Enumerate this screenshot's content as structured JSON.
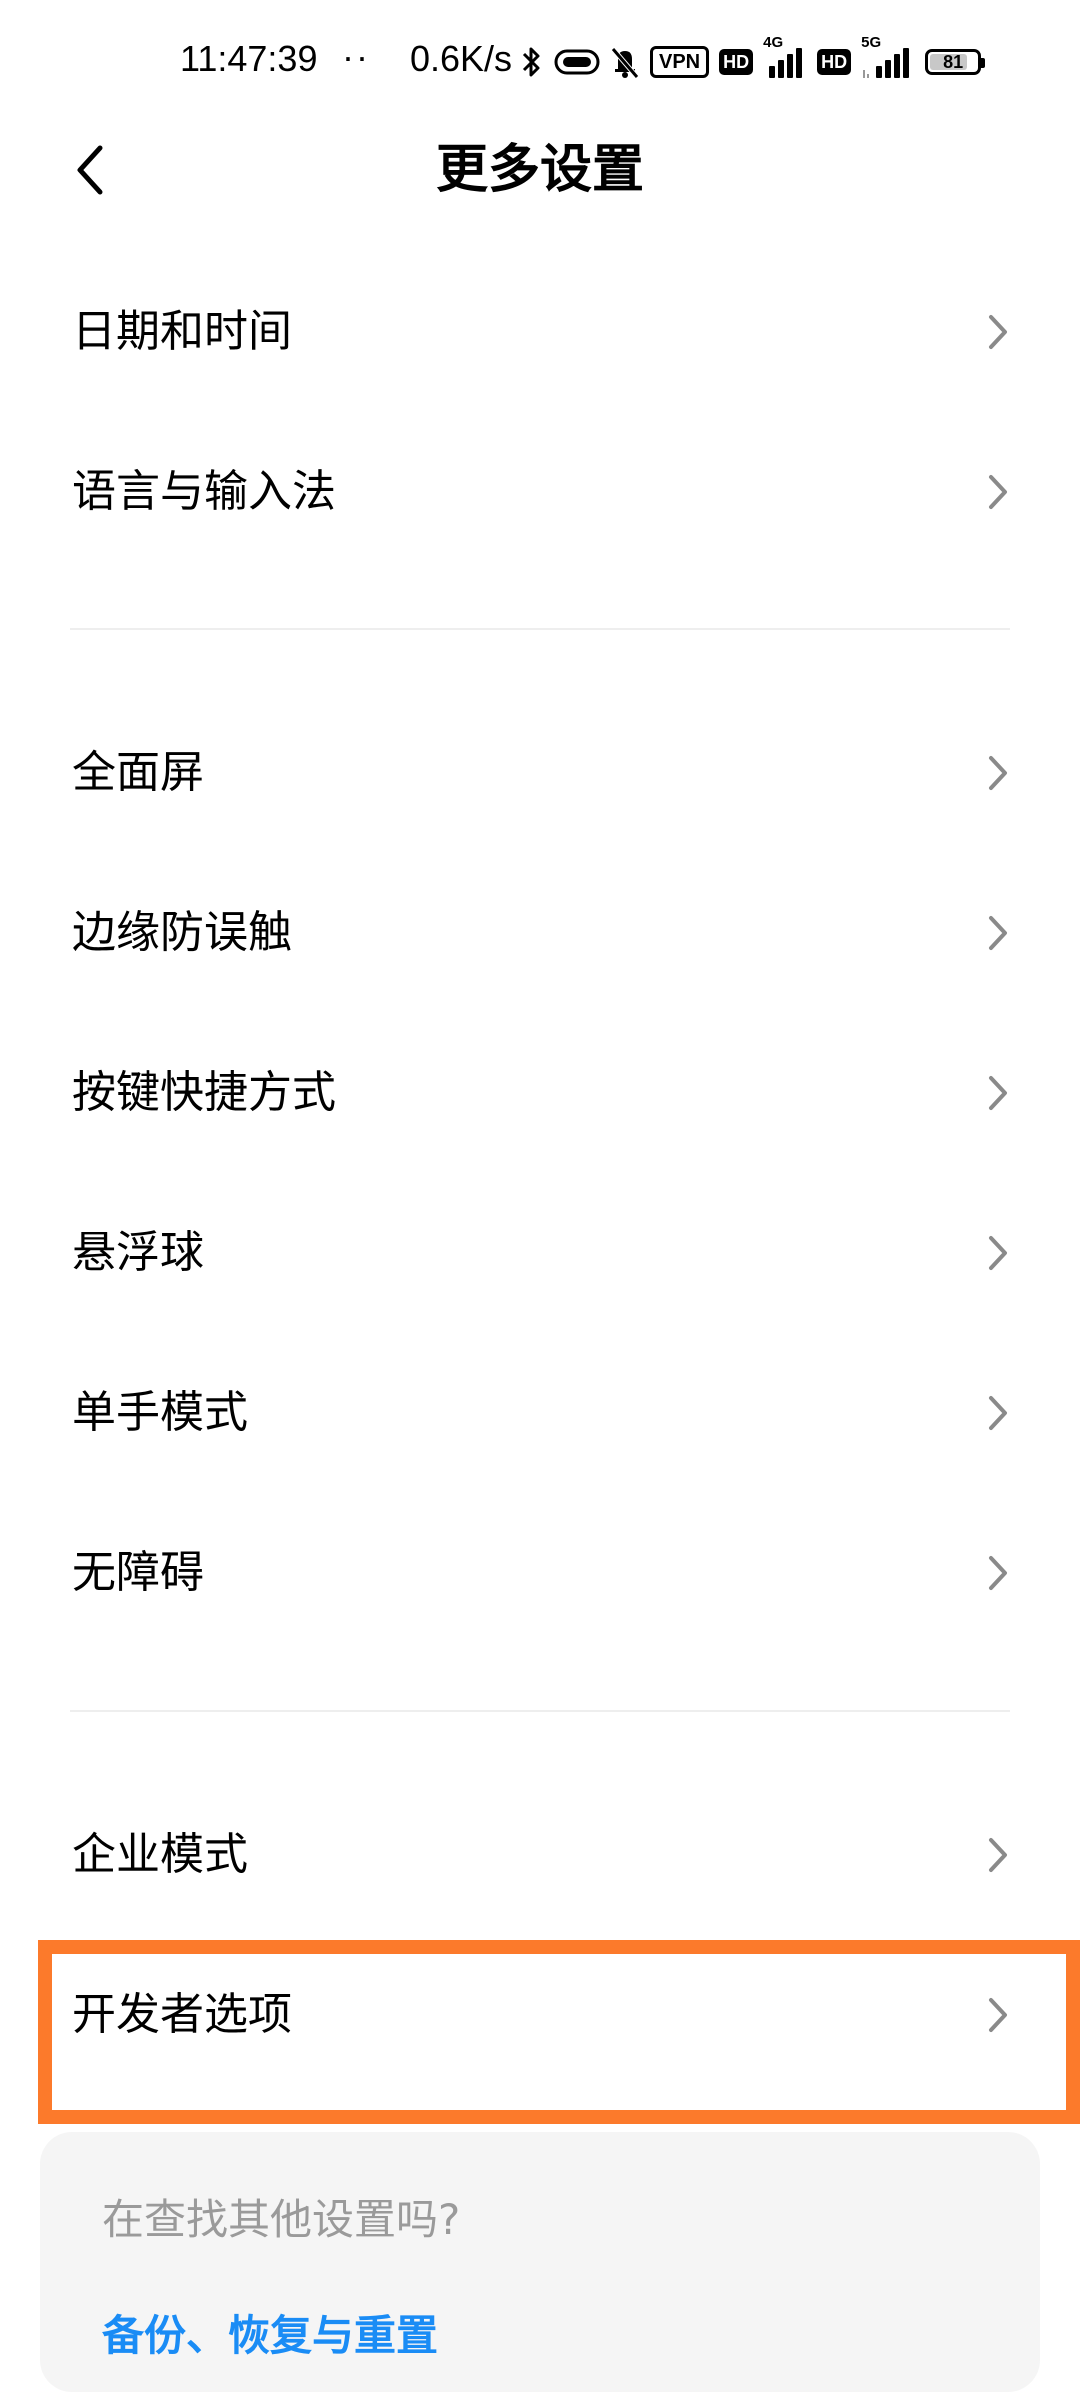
{
  "status_bar": {
    "time": "11:47:39",
    "dots": "··",
    "net_speed": "0.6K/s",
    "vpn_label": "VPN",
    "hd_label": "HD",
    "net1_label": "4G",
    "net2_label": "5G",
    "battery_level": "81",
    "battery_fraction": 0.81,
    "icons": [
      "bluetooth-icon",
      "link-icon",
      "mute-icon",
      "vpn-icon",
      "hd-icon",
      "signal-4g-icon",
      "hd-icon",
      "signal-5g-icon",
      "battery-icon"
    ]
  },
  "header": {
    "title": "更多设置",
    "back_icon": "back-arrow-icon"
  },
  "groups": [
    {
      "items": [
        "日期和时间",
        "语言与输入法"
      ]
    },
    {
      "items": [
        "全面屏",
        "边缘防误触",
        "按键快捷方式",
        "悬浮球",
        "单手模式",
        "无障碍"
      ]
    },
    {
      "items": [
        "企业模式",
        "开发者选项"
      ]
    }
  ],
  "highlight": {
    "item": "开发者选项",
    "color": "#fc7a2b"
  },
  "search_card": {
    "title": "在查找其他设置吗?",
    "link": "备份、恢复与重置"
  },
  "colors": {
    "background": "#ffffff",
    "divider": "#eeeeee",
    "chevron": "#8a8a8a",
    "card_background": "#f5f5f5",
    "card_title": "#9a9a9a",
    "link": "#1a8cf5"
  }
}
